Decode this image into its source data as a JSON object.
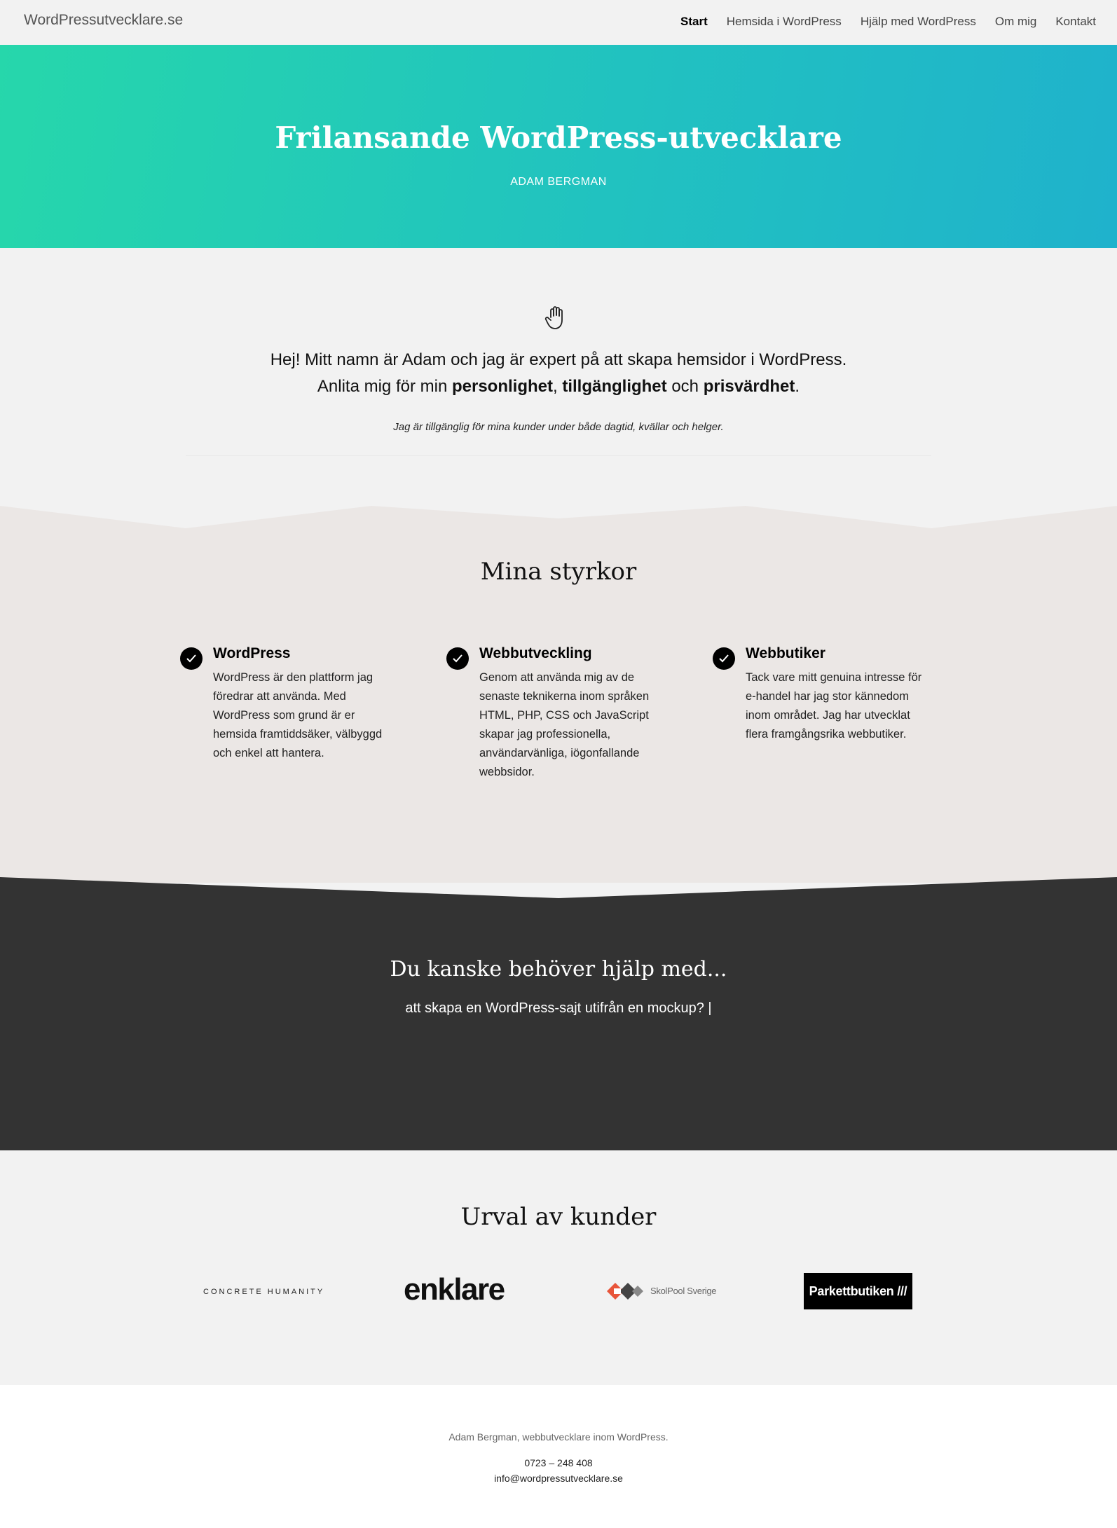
{
  "nav": {
    "brand": "WordPressutvecklare.se",
    "items": [
      {
        "label": "Start",
        "active": true
      },
      {
        "label": "Hemsida i WordPress",
        "active": false
      },
      {
        "label": "Hjälp med WordPress",
        "active": false
      },
      {
        "label": "Om mig",
        "active": false
      },
      {
        "label": "Kontakt",
        "active": false
      }
    ]
  },
  "hero": {
    "title": "Frilansande WordPress-utvecklare",
    "subtitle": "ADAM BERGMAN",
    "gradient_from": "#26d7ab",
    "gradient_to": "#1fb2cc"
  },
  "intro": {
    "icon": "hand-wave-icon",
    "line1": "Hej! Mitt namn är Adam och jag är expert på att skapa hemsidor i WordPress.",
    "line2_prefix": "Anlita mig för min ",
    "line2_bold1": "personlighet",
    "line2_sep": ", ",
    "line2_bold2": "tillgänglighet",
    "line2_mid": " och ",
    "line2_bold3": "prisvärdhet",
    "line2_end": ".",
    "note": "Jag är tillgänglig för mina kunder under både dagtid, kvällar och helger."
  },
  "strengths": {
    "title": "Mina styrkor",
    "background": "#ebe7e5",
    "items": [
      {
        "title": "WordPress",
        "text": "WordPress är den plattform jag föredrar att använda. Med WordPress som grund är er hemsida framtiddsäker, välbyggd och enkel att hantera."
      },
      {
        "title": "Webbutveckling",
        "text": "Genom att använda mig av de senaste teknikerna inom språken HTML, PHP, CSS och JavaScript skapar jag professionella, användarvänliga, iögonfallande webbsidor."
      },
      {
        "title": "Webbutiker",
        "text": "Tack vare mitt genuina intresse för e-handel har jag stor kännedom inom området. Jag har utvecklat flera framgångsrika webbutiker."
      }
    ]
  },
  "help": {
    "title": "Du kanske behöver hjälp med...",
    "text": "att skapa en WordPress-sajt utifrån en mockup? |",
    "background": "#333333"
  },
  "clients": {
    "title": "Urval av kunder",
    "logos": [
      {
        "name": "CONCRETE HUMANITY"
      },
      {
        "name": "enklare"
      },
      {
        "name": "SkolPool Sverige"
      },
      {
        "name": "Parkettbutiken ///"
      }
    ]
  },
  "footer": {
    "tagline": "Adam Bergman, webbutvecklare inom WordPress.",
    "phone": "0723 – 248 408",
    "email": "info@wordpressutvecklare.se"
  }
}
